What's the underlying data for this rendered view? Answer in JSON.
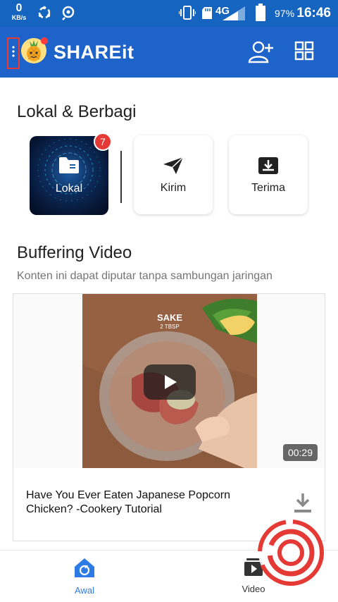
{
  "status_bar": {
    "speed_value": "0",
    "speed_unit": "KB/s",
    "network_type": "4G",
    "battery": "97%",
    "time": "16:46"
  },
  "app_bar": {
    "brand": "SHAREit",
    "icons": [
      "menu-icon",
      "avatar",
      "add-user-icon",
      "grid-icon"
    ]
  },
  "local_section": {
    "title": "Lokal & Berbagi",
    "tiles": [
      {
        "label": "Lokal",
        "icon": "folder-icon",
        "badge": "7"
      },
      {
        "label": "Kirim",
        "icon": "send-icon"
      },
      {
        "label": "Terima",
        "icon": "receive-icon"
      }
    ]
  },
  "video_section": {
    "title": "Buffering Video",
    "subtitle": "Konten ini dapat diputar tanpa sambungan jaringan",
    "card": {
      "overlay_text": "SAKE",
      "overlay_subtext": "2 TBSP",
      "duration": "00:29",
      "title": "Have You Ever Eaten Japanese Popcorn Chicken?  -Cookery Tutorial"
    }
  },
  "bottom_nav": {
    "items": [
      {
        "label": "Awal",
        "active": true
      },
      {
        "label": "Video",
        "active": false
      }
    ],
    "active_color": "#2f7be6",
    "inactive_color": "#333333"
  },
  "colors": {
    "status_bar": "#1565c0",
    "app_bar": "#1e63c9",
    "badge": "#e53935"
  }
}
